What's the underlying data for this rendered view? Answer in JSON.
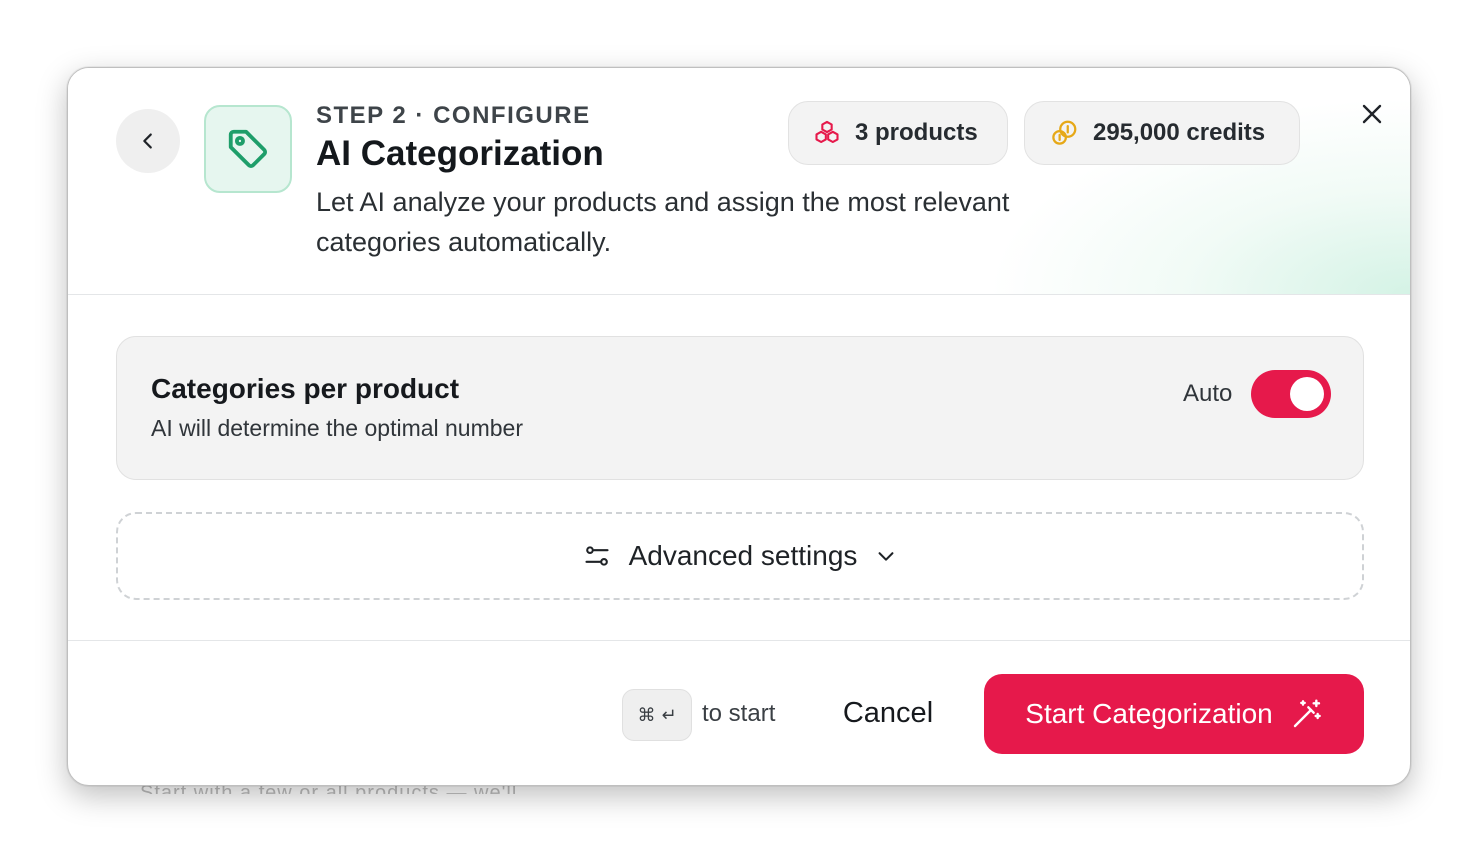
{
  "colors": {
    "accent": "#e6194b",
    "tag_green": "#1e9e6a",
    "credits_gold": "#e6a817"
  },
  "backdrop": {
    "partial_text": "Start with a few or all products — we'll"
  },
  "header": {
    "back_icon": "chevron-left-icon",
    "tile_icon": "tag-icon",
    "step_label": "STEP 2 · CONFIGURE",
    "title": "AI Categorization",
    "subtitle": "Let AI analyze your products and assign the most relevant categories automatically.",
    "products_icon": "cubes-icon",
    "products_label": "3 products",
    "credits_icon": "coins-icon",
    "credits_label": "295,000 credits",
    "close_icon": "close-icon"
  },
  "setting": {
    "title": "Categories per product",
    "description": "AI will determine the optimal number",
    "toggle_label": "Auto",
    "toggle_on": true
  },
  "advanced": {
    "icon": "sliders-icon",
    "label": "Advanced settings",
    "chevron": "chevron-down-icon"
  },
  "footer": {
    "shortcut_cmd": "⌘",
    "shortcut_enter": "↵",
    "shortcut_hint": "to start",
    "cancel_label": "Cancel",
    "start_label": "Start Categorization",
    "start_icon": "magic-wand-icon"
  }
}
